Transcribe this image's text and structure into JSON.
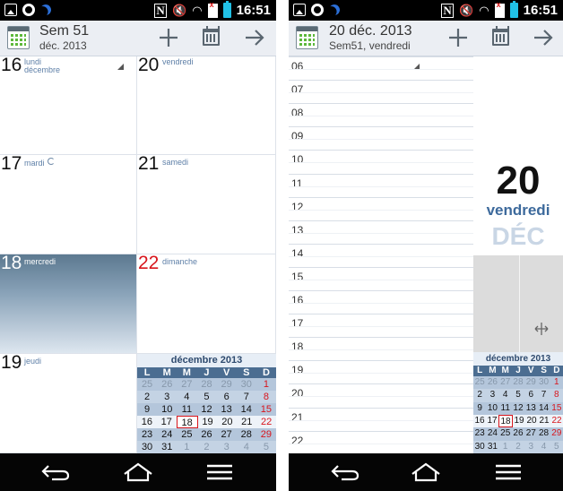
{
  "left": {
    "status": {
      "time": "16:51"
    },
    "header": {
      "title": "Sem 51",
      "subtitle": "déc. 2013"
    },
    "days": [
      {
        "num": "16",
        "name": "lundi",
        "month": "décembre"
      },
      {
        "num": "17",
        "name": "mardi"
      },
      {
        "num": "18",
        "name": "mercredi"
      },
      {
        "num": "19",
        "name": "jeudi"
      },
      {
        "num": "20",
        "name": "vendredi"
      },
      {
        "num": "21",
        "name": "samedi"
      },
      {
        "num": "22",
        "name": "dimanche"
      }
    ],
    "mini_cal": {
      "title": "décembre 2013",
      "weekdays": [
        "L",
        "M",
        "M",
        "J",
        "V",
        "S",
        "D"
      ],
      "rows": [
        [
          "25",
          "26",
          "27",
          "28",
          "29",
          "30",
          "1"
        ],
        [
          "2",
          "3",
          "4",
          "5",
          "6",
          "7",
          "8"
        ],
        [
          "9",
          "10",
          "11",
          "12",
          "13",
          "14",
          "15"
        ],
        [
          "16",
          "17",
          "18",
          "19",
          "20",
          "21",
          "22"
        ],
        [
          "23",
          "24",
          "25",
          "26",
          "27",
          "28",
          "29"
        ],
        [
          "30",
          "31",
          "1",
          "2",
          "3",
          "4",
          "5"
        ]
      ]
    }
  },
  "right": {
    "status": {
      "time": "16:51"
    },
    "header": {
      "title": "20 déc. 2013",
      "subtitle": "Sem51, vendredi"
    },
    "hours": [
      "06",
      "07",
      "08",
      "09",
      "10",
      "11",
      "12",
      "13",
      "14",
      "15",
      "16",
      "17",
      "18",
      "19",
      "20",
      "21",
      "22"
    ],
    "selected_day": {
      "num": "20",
      "weekday": "vendredi",
      "month": "DÉC"
    },
    "mini_cal": {
      "title": "décembre 2013",
      "weekdays": [
        "L",
        "M",
        "M",
        "J",
        "V",
        "S",
        "D"
      ],
      "rows": [
        [
          "25",
          "26",
          "27",
          "28",
          "29",
          "30",
          "1"
        ],
        [
          "2",
          "3",
          "4",
          "5",
          "6",
          "7",
          "8"
        ],
        [
          "9",
          "10",
          "11",
          "12",
          "13",
          "14",
          "15"
        ],
        [
          "16",
          "17",
          "18",
          "19",
          "20",
          "21",
          "22"
        ],
        [
          "23",
          "24",
          "25",
          "26",
          "27",
          "28",
          "29"
        ],
        [
          "30",
          "31",
          "1",
          "2",
          "3",
          "4",
          "5"
        ]
      ]
    }
  },
  "icons": {
    "status": [
      "gallery-icon",
      "chrome-icon",
      "night-icon",
      "nfc-icon",
      "mute-icon",
      "wifi-icon",
      "no-sim-icon",
      "battery-icon"
    ],
    "header": [
      "calendar-app-icon",
      "add-icon",
      "go-to-date-icon",
      "forward-arrow-icon"
    ],
    "nav": [
      "back-icon",
      "home-icon",
      "menu-icon"
    ]
  },
  "colors": {
    "accent": "#4b6d91",
    "sunday": "#d8151c",
    "today_gradient_top": "#5c7990",
    "day_label": "#5f80a8"
  }
}
